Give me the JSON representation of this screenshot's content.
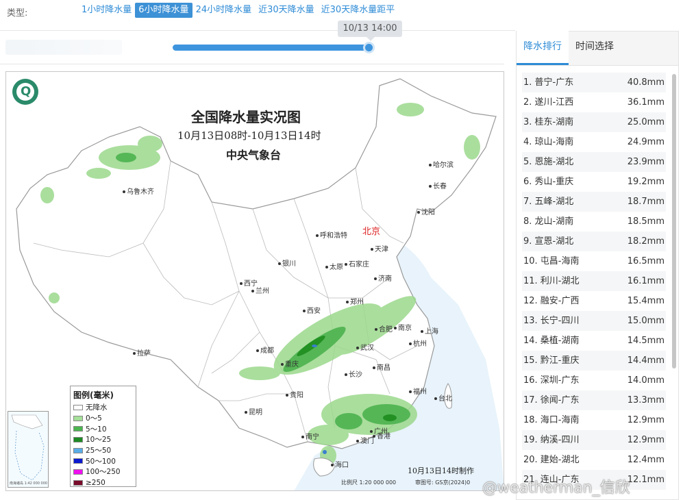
{
  "type_bar": {
    "label": "类型:",
    "tabs": [
      "1小时降水量",
      "6小时降水量",
      "24小时降水量",
      "近30天降水量",
      "近30天降水量距平"
    ]
  },
  "slider": {
    "time_label": "10/13 14:00"
  },
  "map": {
    "title": "全国降水量实况图",
    "subtitle": "10月13日08时-10月13日14时",
    "organization": "中央气象台",
    "cities": [
      "乌鲁木齐",
      "哈尔滨",
      "长春",
      "沈阳",
      "北京",
      "呼和浩特",
      "天津",
      "银川",
      "太原",
      "石家庄",
      "西宁",
      "兰州",
      "济南",
      "郑州",
      "西安",
      "南京",
      "合肥",
      "上海",
      "杭州",
      "拉萨",
      "成都",
      "武汉",
      "重庆",
      "南昌",
      "长沙",
      "贵阳",
      "福州",
      "台北",
      "昆明",
      "南宁",
      "广州",
      "澳门",
      "香港",
      "海口"
    ],
    "legend": {
      "title": "图例(毫米)",
      "items": [
        "无降水",
        "0～5",
        "5～10",
        "10～25",
        "25～50",
        "50～100",
        "100～250",
        "≥250"
      ]
    },
    "inset_caption": "南海诸岛 1:42 000 000",
    "made_time": "10月13日14时制作",
    "scale": "比例尺 1:20 000 000",
    "review_no": "审图号: GS京(2024)0"
  },
  "panel": {
    "tabs": [
      "降水排行",
      "时间选择"
    ],
    "ranking": [
      {
        "name": "1. 普宁-广东",
        "value": "40.8mm"
      },
      {
        "name": "2. 遂川-江西",
        "value": "36.1mm"
      },
      {
        "name": "3. 桂东-湖南",
        "value": "25.0mm"
      },
      {
        "name": "4. 琼山-海南",
        "value": "24.9mm"
      },
      {
        "name": "5. 恩施-湖北",
        "value": "23.9mm"
      },
      {
        "name": "6. 秀山-重庆",
        "value": "19.2mm"
      },
      {
        "name": "7. 五峰-湖北",
        "value": "18.7mm"
      },
      {
        "name": "8. 龙山-湖南",
        "value": "18.5mm"
      },
      {
        "name": "9. 宣恩-湖北",
        "value": "18.2mm"
      },
      {
        "name": "10. 屯昌-海南",
        "value": "16.5mm"
      },
      {
        "name": "11. 利川-湖北",
        "value": "16.1mm"
      },
      {
        "name": "12. 融安-广西",
        "value": "15.4mm"
      },
      {
        "name": "13. 长宁-四川",
        "value": "15.0mm"
      },
      {
        "name": "14. 桑植-湖南",
        "value": "14.5mm"
      },
      {
        "name": "15. 黔江-重庆",
        "value": "14.4mm"
      },
      {
        "name": "16. 深圳-广东",
        "value": "14.0mm"
      },
      {
        "name": "17. 徐闻-广东",
        "value": "13.3mm"
      },
      {
        "name": "18. 海口-海南",
        "value": "12.9mm"
      },
      {
        "name": "19. 纳溪-四川",
        "value": "12.9mm"
      },
      {
        "name": "20. 建始-湖北",
        "value": "12.4mm"
      },
      {
        "name": "21. 连山-广东",
        "value": "12.1mm"
      }
    ]
  },
  "watermark": "@weatherman_信欣"
}
